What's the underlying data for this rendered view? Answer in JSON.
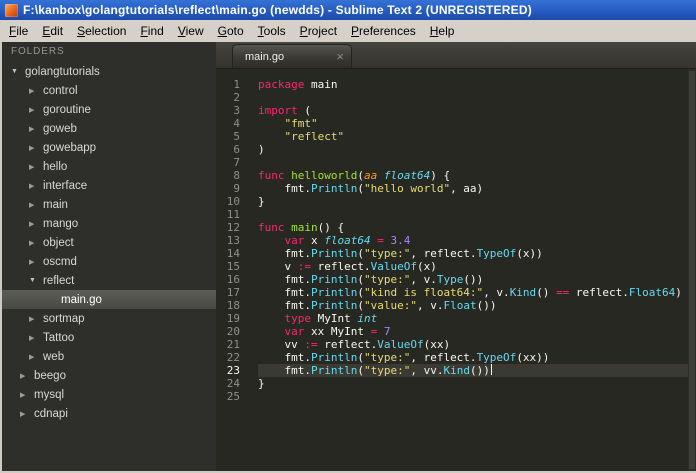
{
  "window": {
    "title": "F:\\kanbox\\golangtutorials\\reflect\\main.go (newdds) - Sublime Text 2 (UNREGISTERED)"
  },
  "theme": {
    "titlebar-top": "#3572d6",
    "titlebar-bottom": "#1b4aac",
    "titlebar-text": "#ffffff",
    "menubar-bg": "#d5d1c9",
    "menubar-text": "#000000",
    "sidebar-bg": "#2e2e2a",
    "sidebar-text": "#d8d8d4",
    "sidebar-header-text": "#96968e",
    "editor-bg": "#272822",
    "editor-text": "#f8f8f2",
    "gutter-text": "#8f908a",
    "current-line-bg": "#3a3a32",
    "tabbar-top": "#45443f",
    "tabbar-bottom": "#34332d",
    "tab-text": "#f0f0ec",
    "keyword": "#f92672",
    "string": "#e6db74",
    "number": "#ae81ff",
    "function-call": "#66d9ef",
    "type": "#66d9ef",
    "func-name": "#a6e22e",
    "param": "#fd971f"
  },
  "menu": {
    "items": [
      {
        "label": "File",
        "u": 0
      },
      {
        "label": "Edit",
        "u": 0
      },
      {
        "label": "Selection",
        "u": 0
      },
      {
        "label": "Find",
        "u": 0
      },
      {
        "label": "View",
        "u": 0
      },
      {
        "label": "Goto",
        "u": 0
      },
      {
        "label": "Tools",
        "u": 0
      },
      {
        "label": "Project",
        "u": 0
      },
      {
        "label": "Preferences",
        "u": 0
      },
      {
        "label": "Help",
        "u": 0
      }
    ]
  },
  "sidebar": {
    "header": "FOLDERS",
    "items": [
      {
        "label": "golangtutorials",
        "depth": 0,
        "arrow": "down",
        "type": "folder",
        "selected": false
      },
      {
        "label": "control",
        "depth": 1,
        "arrow": "right",
        "type": "folder",
        "selected": false
      },
      {
        "label": "goroutine",
        "depth": 1,
        "arrow": "right",
        "type": "folder",
        "selected": false
      },
      {
        "label": "goweb",
        "depth": 1,
        "arrow": "right",
        "type": "folder",
        "selected": false
      },
      {
        "label": "gowebapp",
        "depth": 1,
        "arrow": "right",
        "type": "folder",
        "selected": false
      },
      {
        "label": "hello",
        "depth": 1,
        "arrow": "right",
        "type": "folder",
        "selected": false
      },
      {
        "label": "interface",
        "depth": 1,
        "arrow": "right",
        "type": "folder",
        "selected": false
      },
      {
        "label": "main",
        "depth": 1,
        "arrow": "right",
        "type": "folder",
        "selected": false
      },
      {
        "label": "mango",
        "depth": 1,
        "arrow": "right",
        "type": "folder",
        "selected": false
      },
      {
        "label": "object",
        "depth": 1,
        "arrow": "right",
        "type": "folder",
        "selected": false
      },
      {
        "label": "oscmd",
        "depth": 1,
        "arrow": "right",
        "type": "folder",
        "selected": false
      },
      {
        "label": "reflect",
        "depth": 1,
        "arrow": "down",
        "type": "folder",
        "selected": false
      },
      {
        "label": "main.go",
        "depth": 2,
        "arrow": null,
        "type": "file",
        "selected": true
      },
      {
        "label": "sortmap",
        "depth": 1,
        "arrow": "right",
        "type": "folder",
        "selected": false
      },
      {
        "label": "Tattoo",
        "depth": 1,
        "arrow": "right",
        "type": "folder",
        "selected": false
      },
      {
        "label": "web",
        "depth": 1,
        "arrow": "right",
        "type": "folder",
        "selected": false
      },
      {
        "label": "beego",
        "depth": 0.5,
        "arrow": "right",
        "type": "folder",
        "selected": false
      },
      {
        "label": "mysql",
        "depth": 0.5,
        "arrow": "right",
        "type": "folder",
        "selected": false
      },
      {
        "label": "cdnapi",
        "depth": 0.5,
        "arrow": "right",
        "type": "folder",
        "selected": false
      }
    ]
  },
  "editor": {
    "tab": {
      "label": "main.go",
      "close": "×"
    },
    "current_line": 23,
    "lines": [
      [
        [
          "kw",
          "package"
        ],
        [
          "pl",
          " main"
        ]
      ],
      [],
      [
        [
          "kw",
          "import"
        ],
        [
          "pl",
          " ("
        ]
      ],
      [
        [
          "pl",
          "    "
        ],
        [
          "str",
          "\"fmt\""
        ]
      ],
      [
        [
          "pl",
          "    "
        ],
        [
          "str",
          "\"reflect\""
        ]
      ],
      [
        [
          "pl",
          ")"
        ]
      ],
      [],
      [
        [
          "kw",
          "func"
        ],
        [
          "pl",
          " "
        ],
        [
          "fng",
          "helloworld"
        ],
        [
          "pl",
          "("
        ],
        [
          "par",
          "aa"
        ],
        [
          "pl",
          " "
        ],
        [
          "ty",
          "float64"
        ],
        [
          "pl",
          ") {"
        ]
      ],
      [
        [
          "pl",
          "    fmt."
        ],
        [
          "fn",
          "Println"
        ],
        [
          "pl",
          "("
        ],
        [
          "str",
          "\"hello world\""
        ],
        [
          "pl",
          ", aa)"
        ]
      ],
      [
        [
          "pl",
          "}"
        ]
      ],
      [],
      [
        [
          "kw",
          "func"
        ],
        [
          "pl",
          " "
        ],
        [
          "fng",
          "main"
        ],
        [
          "pl",
          "() {"
        ]
      ],
      [
        [
          "pl",
          "    "
        ],
        [
          "kw",
          "var"
        ],
        [
          "pl",
          " x "
        ],
        [
          "ty",
          "float64"
        ],
        [
          "pl",
          " "
        ],
        [
          "kw",
          "="
        ],
        [
          "pl",
          " "
        ],
        [
          "num",
          "3.4"
        ]
      ],
      [
        [
          "pl",
          "    fmt."
        ],
        [
          "fn",
          "Println"
        ],
        [
          "pl",
          "("
        ],
        [
          "str",
          "\"type:\""
        ],
        [
          "pl",
          ", reflect."
        ],
        [
          "fn",
          "TypeOf"
        ],
        [
          "pl",
          "(x))"
        ]
      ],
      [
        [
          "pl",
          "    v "
        ],
        [
          "kw",
          ":="
        ],
        [
          "pl",
          " reflect."
        ],
        [
          "fn",
          "ValueOf"
        ],
        [
          "pl",
          "(x)"
        ]
      ],
      [
        [
          "pl",
          "    fmt."
        ],
        [
          "fn",
          "Println"
        ],
        [
          "pl",
          "("
        ],
        [
          "str",
          "\"type:\""
        ],
        [
          "pl",
          ", v."
        ],
        [
          "fn",
          "Type"
        ],
        [
          "pl",
          "())"
        ]
      ],
      [
        [
          "pl",
          "    fmt."
        ],
        [
          "fn",
          "Println"
        ],
        [
          "pl",
          "("
        ],
        [
          "str",
          "\"kind is float64:\""
        ],
        [
          "pl",
          ", v."
        ],
        [
          "fn",
          "Kind"
        ],
        [
          "pl",
          "() "
        ],
        [
          "kw",
          "=="
        ],
        [
          "pl",
          " reflect."
        ],
        [
          "fn",
          "Float64"
        ],
        [
          "pl",
          ")"
        ]
      ],
      [
        [
          "pl",
          "    fmt."
        ],
        [
          "fn",
          "Println"
        ],
        [
          "pl",
          "("
        ],
        [
          "str",
          "\"value:\""
        ],
        [
          "pl",
          ", v."
        ],
        [
          "fn",
          "Float"
        ],
        [
          "pl",
          "())"
        ]
      ],
      [
        [
          "pl",
          "    "
        ],
        [
          "kw",
          "type"
        ],
        [
          "pl",
          " MyInt "
        ],
        [
          "ty",
          "int"
        ]
      ],
      [
        [
          "pl",
          "    "
        ],
        [
          "kw",
          "var"
        ],
        [
          "pl",
          " xx MyInt "
        ],
        [
          "kw",
          "="
        ],
        [
          "pl",
          " "
        ],
        [
          "num",
          "7"
        ]
      ],
      [
        [
          "pl",
          "    vv "
        ],
        [
          "kw",
          ":="
        ],
        [
          "pl",
          " reflect."
        ],
        [
          "fn",
          "ValueOf"
        ],
        [
          "pl",
          "(xx)"
        ]
      ],
      [
        [
          "pl",
          "    fmt."
        ],
        [
          "fn",
          "Println"
        ],
        [
          "pl",
          "("
        ],
        [
          "str",
          "\"type:\""
        ],
        [
          "pl",
          ", reflect."
        ],
        [
          "fn",
          "TypeOf"
        ],
        [
          "pl",
          "(xx))"
        ]
      ],
      [
        [
          "pl",
          "    fmt."
        ],
        [
          "fn",
          "Println"
        ],
        [
          "pl",
          "("
        ],
        [
          "str",
          "\"type:\""
        ],
        [
          "pl",
          ", vv."
        ],
        [
          "fn",
          "Kind"
        ],
        [
          "pl",
          "())"
        ]
      ],
      [
        [
          "pl",
          "}"
        ]
      ],
      []
    ]
  }
}
